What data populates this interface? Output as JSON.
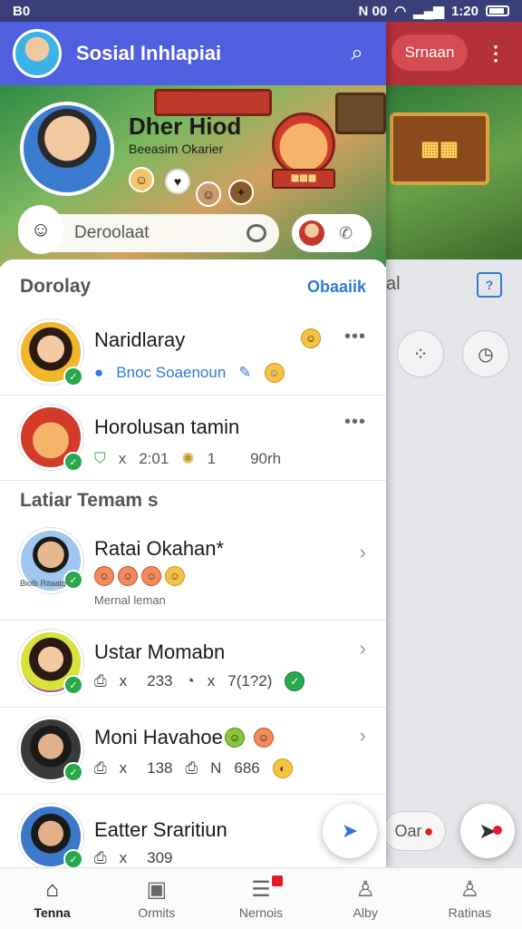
{
  "status_bar": {
    "left": "B0",
    "right": "N 00",
    "time": "1:20"
  },
  "app_bar": {
    "title": "Sosial Inhlapiai"
  },
  "profile": {
    "name": "Dher Hiod",
    "subtitle": "Beeasim Okarier"
  },
  "search": {
    "placeholder": "Deroolaat"
  },
  "background_panel": {
    "pill_label": "Srnaan",
    "cut_label": "al",
    "chip_label": "Oar"
  },
  "primary_section": {
    "title": "Dorolay",
    "action": "Obaaiik",
    "items": [
      {
        "name": "Naridlaray",
        "meta1": "Bnoc Soaenoun"
      },
      {
        "name": "Horolusan tamin",
        "meta1": "x",
        "meta2": "2:01",
        "meta3": "1",
        "meta4": "90rh"
      }
    ]
  },
  "secondary_section": {
    "title": "Latiar Temam s",
    "items": [
      {
        "name": "Ratai Okahan*",
        "meta1": "Mernal leman",
        "badge": "Biolb Ritaato"
      },
      {
        "name": "Ustar Momabn",
        "meta1": "x",
        "meta2": "233",
        "meta3": "x",
        "meta4": "7(1?2)"
      },
      {
        "name": "Moni Havahoe",
        "meta1": "x",
        "meta2": "138",
        "meta3": "N",
        "meta4": "686"
      },
      {
        "name": "Eatter Sraritiun",
        "meta1": "x",
        "meta2": "309"
      }
    ]
  },
  "bottom_nav": [
    {
      "label": "Tenna",
      "icon": "home-icon",
      "active": true
    },
    {
      "label": "Ormits",
      "icon": "photos-icon",
      "active": false
    },
    {
      "label": "Nernois",
      "icon": "news-icon",
      "active": false
    },
    {
      "label": "Alby",
      "icon": "person-icon",
      "active": false
    },
    {
      "label": "Ratinas",
      "icon": "person-icon",
      "active": false
    }
  ],
  "colors": {
    "app_bar": "#4f5fe0",
    "accent_blue": "#2f7bd6",
    "online_green": "#27a84a",
    "background_red": "#b5313a"
  }
}
